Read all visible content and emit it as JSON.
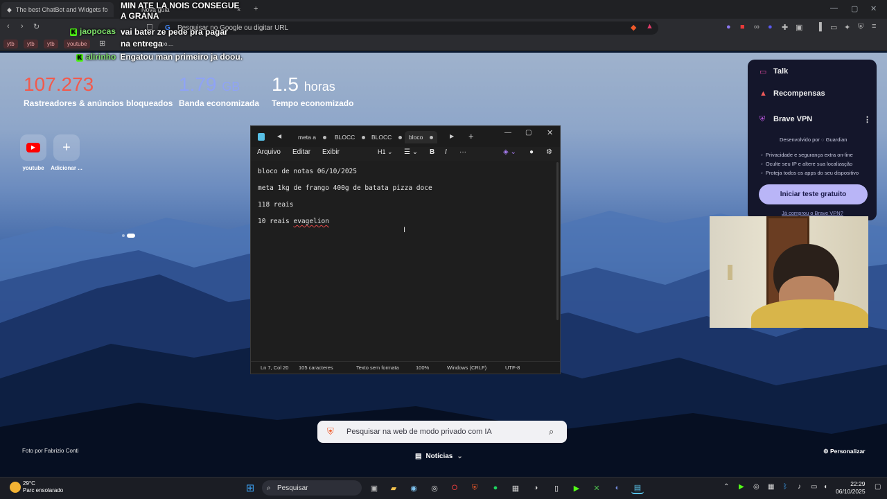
{
  "browser": {
    "tabs": [
      {
        "label": "The best ChatBot and Widgets for Ki"
      },
      {
        "label": "Nova guia"
      }
    ],
    "url_placeholder": "Pesquisar no Google ou digitar URL",
    "bookmarks": [
      "ytb",
      "ytb",
      "ytb",
      "youtube"
    ],
    "bookmark_extra": "Bate papo...."
  },
  "chat": {
    "messages": [
      {
        "user": "",
        "text": "MIN ATE LA NOIS CONSEGUE A GRANA"
      },
      {
        "user": "jaopocas",
        "text": "vai bater ze pede pra pagar na entrega"
      },
      {
        "user": "alirinho",
        "text": "Engatou man primeiro ja doou."
      }
    ]
  },
  "stats": {
    "trackers": {
      "value": "107.273",
      "label": "Rastreadores & anúncios bloqueados"
    },
    "bandwidth": {
      "value": "1.79",
      "unit": "GB",
      "label": "Banda economizada"
    },
    "time": {
      "value": "1.5",
      "unit": "horas",
      "label": "Tempo economizado"
    }
  },
  "shortcuts": [
    {
      "label": "youtube",
      "icon": "youtube-icon"
    },
    {
      "label": "Adicionar ...",
      "icon": "plus-icon"
    }
  ],
  "brave_panel": {
    "talk": "Talk",
    "rewards": "Recompensas",
    "vpn": "Brave VPN",
    "developed_by": "Desenvolvido por",
    "partner": "Guardian",
    "features": [
      "Privacidade e segurança extra on-line",
      "Oculte seu IP e altere sua localização",
      "Proteja todos os apps do seu dispositivo"
    ],
    "trial_button": "Iniciar teste gratuito",
    "already_bought": "Já comprou o Brave VPN?"
  },
  "notepad": {
    "tabs": [
      "meta a",
      "BLOCC",
      "BLOCC",
      "bloco"
    ],
    "menu": [
      "Arquivo",
      "Editar",
      "Exibir"
    ],
    "heading_select": "H1",
    "lines": [
      "bloco de notas 06/10/2025",
      "meta 1kg de frango 400g de batata pizza doce",
      "118 reais"
    ],
    "last_line_prefix": "10 reais ",
    "last_line_misspelled": "evagelion",
    "status": {
      "position": "Ln 7, Col 20",
      "chars": "105 caracteres",
      "format": "Texto sem formata",
      "zoom": "100%",
      "line_ending": "Windows (CRLF)",
      "encoding": "UTF-8"
    }
  },
  "newtab": {
    "search_placeholder": "Pesquisar na web de modo privado com IA",
    "news": "Notícias",
    "photo_credit": "Foto por Fabrizio Conti",
    "personalize": "Personalizar"
  },
  "taskbar": {
    "weather_temp": "29°C",
    "weather_desc": "Parc ensolarado",
    "search": "Pesquisar",
    "time": "22:29",
    "date": "06/10/2025"
  }
}
